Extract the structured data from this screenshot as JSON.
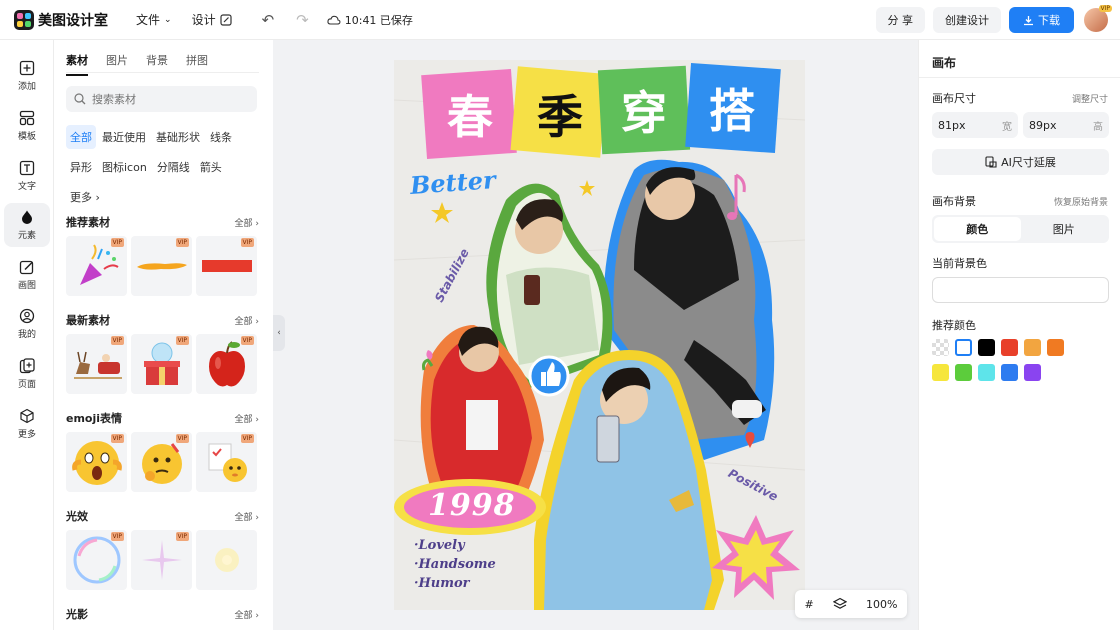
{
  "topbar": {
    "app_name": "美图设计室",
    "menu_file": "文件",
    "menu_design": "设计",
    "save_status": "10:41 已保存",
    "share_label": "分 享",
    "create_label": "创建设计",
    "download_label": "下载",
    "avatar_badge": "VIP"
  },
  "rail": [
    {
      "label": "添加",
      "icon": "plus-square-icon"
    },
    {
      "label": "模板",
      "icon": "template-icon"
    },
    {
      "label": "文字",
      "icon": "text-icon"
    },
    {
      "label": "元素",
      "icon": "shapes-icon"
    },
    {
      "label": "画图",
      "icon": "draw-icon"
    },
    {
      "label": "我的",
      "icon": "user-icon"
    },
    {
      "label": "页面",
      "icon": "page-icon"
    },
    {
      "label": "更多",
      "icon": "cube-icon"
    }
  ],
  "panel": {
    "tabs": [
      "素材",
      "图片",
      "背景",
      "拼图"
    ],
    "search_placeholder": "搜索素材",
    "chips": [
      "全部",
      "最近使用",
      "基础形状",
      "线条",
      "异形",
      "图标icon",
      "分隔线",
      "箭头",
      "更多"
    ],
    "all_label": "全部",
    "vip": "VIP",
    "sections": [
      {
        "title": "推荐素材"
      },
      {
        "title": "最新素材"
      },
      {
        "title": "emoji表情"
      },
      {
        "title": "光效"
      },
      {
        "title": "光影"
      }
    ]
  },
  "poster": {
    "title_chars": [
      "春",
      "季",
      "穿",
      "搭"
    ],
    "better": "Better",
    "stabilize": "Stabilize",
    "year": "1998",
    "positive": "Positive",
    "lovely": "·Lovely",
    "handsome": "·Handsome",
    "humor": "·Humor"
  },
  "zoom": {
    "value": "100%"
  },
  "right_panel": {
    "title": "画布",
    "size_label": "画布尺寸",
    "adjust_size": "调整尺寸",
    "width_value": "81px",
    "width_unit": "宽",
    "height_value": "89px",
    "height_unit": "高",
    "ai_extend": "AI尺寸延展",
    "bg_label": "画布背景",
    "restore_bg": "恢复原始背景",
    "seg_color": "颜色",
    "seg_image": "图片",
    "current_bg": "当前背景色",
    "recommended": "推荐颜色",
    "swatches": [
      "transparent",
      "#ffffff",
      "#000000",
      "#e8402a",
      "#f2a540",
      "#f07a22",
      "#f6e63c",
      "#5ccc3c",
      "#5ee4ea",
      "#2e7cf0",
      "#8a44f0"
    ]
  },
  "colors": {
    "accent": "#1f7ff5",
    "title_pink": "#f07ac0",
    "title_yellow": "#f6e046",
    "title_green": "#5fbf5a",
    "title_blue": "#2f8ff0"
  }
}
